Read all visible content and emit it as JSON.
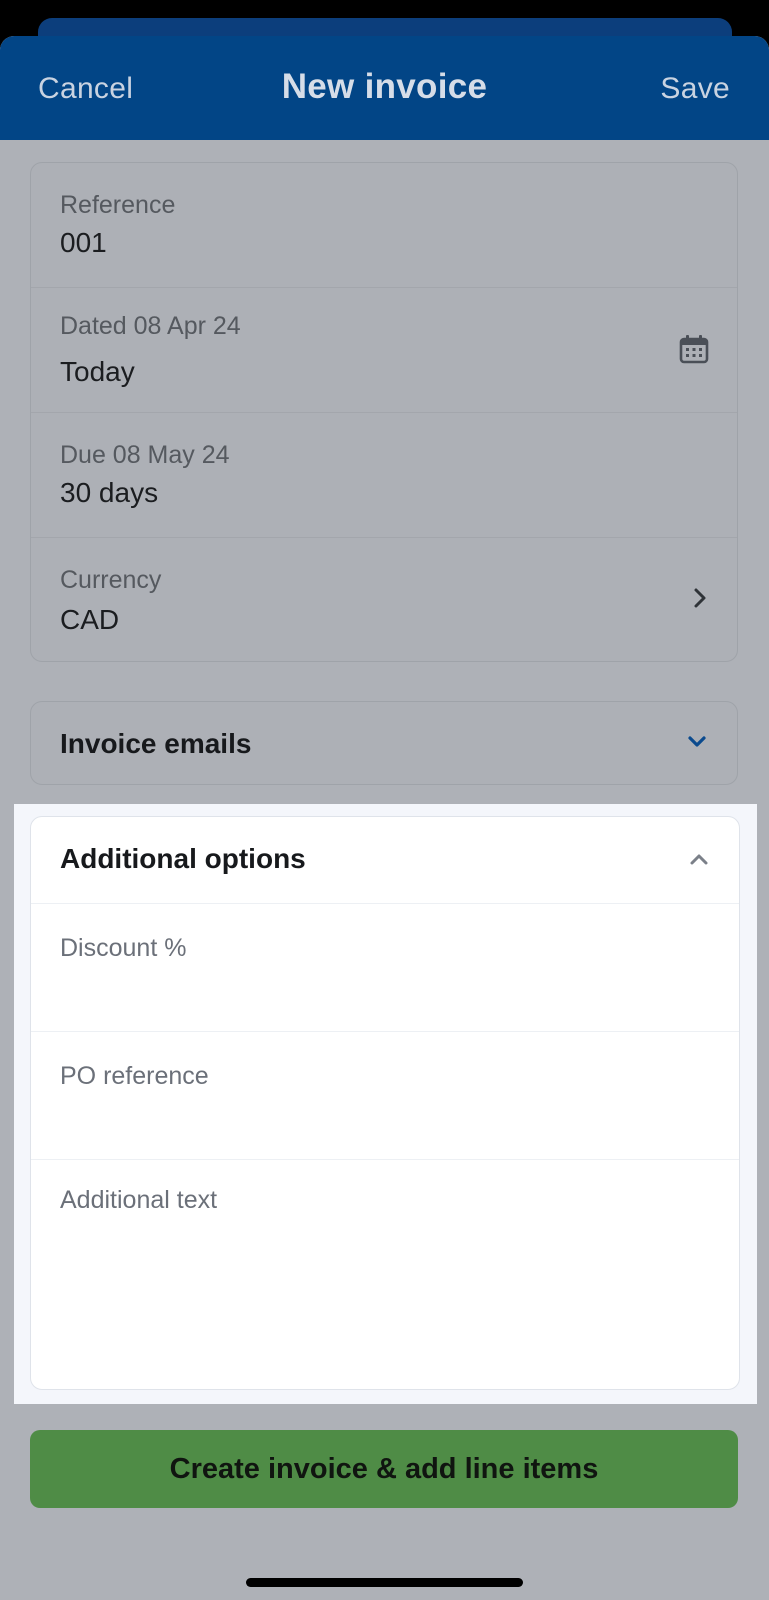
{
  "navbar": {
    "cancel_label": "Cancel",
    "title": "New invoice",
    "save_label": "Save"
  },
  "details": {
    "reference": {
      "label": "Reference",
      "value": "001"
    },
    "dated": {
      "label": "Dated 08 Apr 24",
      "value": "Today",
      "icon": "calendar-icon"
    },
    "due": {
      "label": "Due 08 May 24",
      "value": "30 days"
    },
    "currency": {
      "label": "Currency",
      "value": "CAD",
      "icon": "chevron-right-icon"
    }
  },
  "invoice_emails": {
    "title": "Invoice emails",
    "icon": "chevron-down-icon",
    "expanded": false
  },
  "additional_options": {
    "title": "Additional options",
    "icon": "chevron-up-icon",
    "expanded": true,
    "fields": {
      "discount": {
        "placeholder": "Discount %"
      },
      "po_reference": {
        "placeholder": "PO reference"
      },
      "additional_text": {
        "placeholder": "Additional text"
      }
    }
  },
  "create_button_label": "Create invoice & add line items",
  "colors": {
    "navbar": "#024586",
    "accent_blue": "#0b4a8e",
    "create_button": "#4f8c46",
    "overlay_background": "#aeb1b7"
  }
}
